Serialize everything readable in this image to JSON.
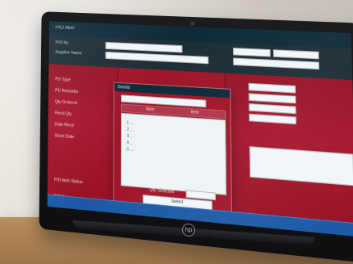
{
  "photo": {
    "brand_logo_text": "hp"
  },
  "ui": {
    "app_title": "P/O Item",
    "top_left_labels": [
      "P/O No",
      "Supplier Name"
    ],
    "left_labels": [
      "PO Type",
      "PO Remarks",
      "Qty Ordered",
      "Recd Qty",
      "Date Recd",
      "Stock Date"
    ],
    "bottom_left_labels": [
      "P/O Item Status",
      "P/O Date"
    ],
    "modal": {
      "title": "Goods",
      "search_placeholder": "",
      "tabs": [
        "Item",
        "Item"
      ],
      "list_items": [
        "1 ...",
        "2 ...",
        "3 ...",
        "4 ...",
        "5 ..."
      ],
      "qty_label": "Qty Selected",
      "select_button_label": "Select"
    }
  }
}
